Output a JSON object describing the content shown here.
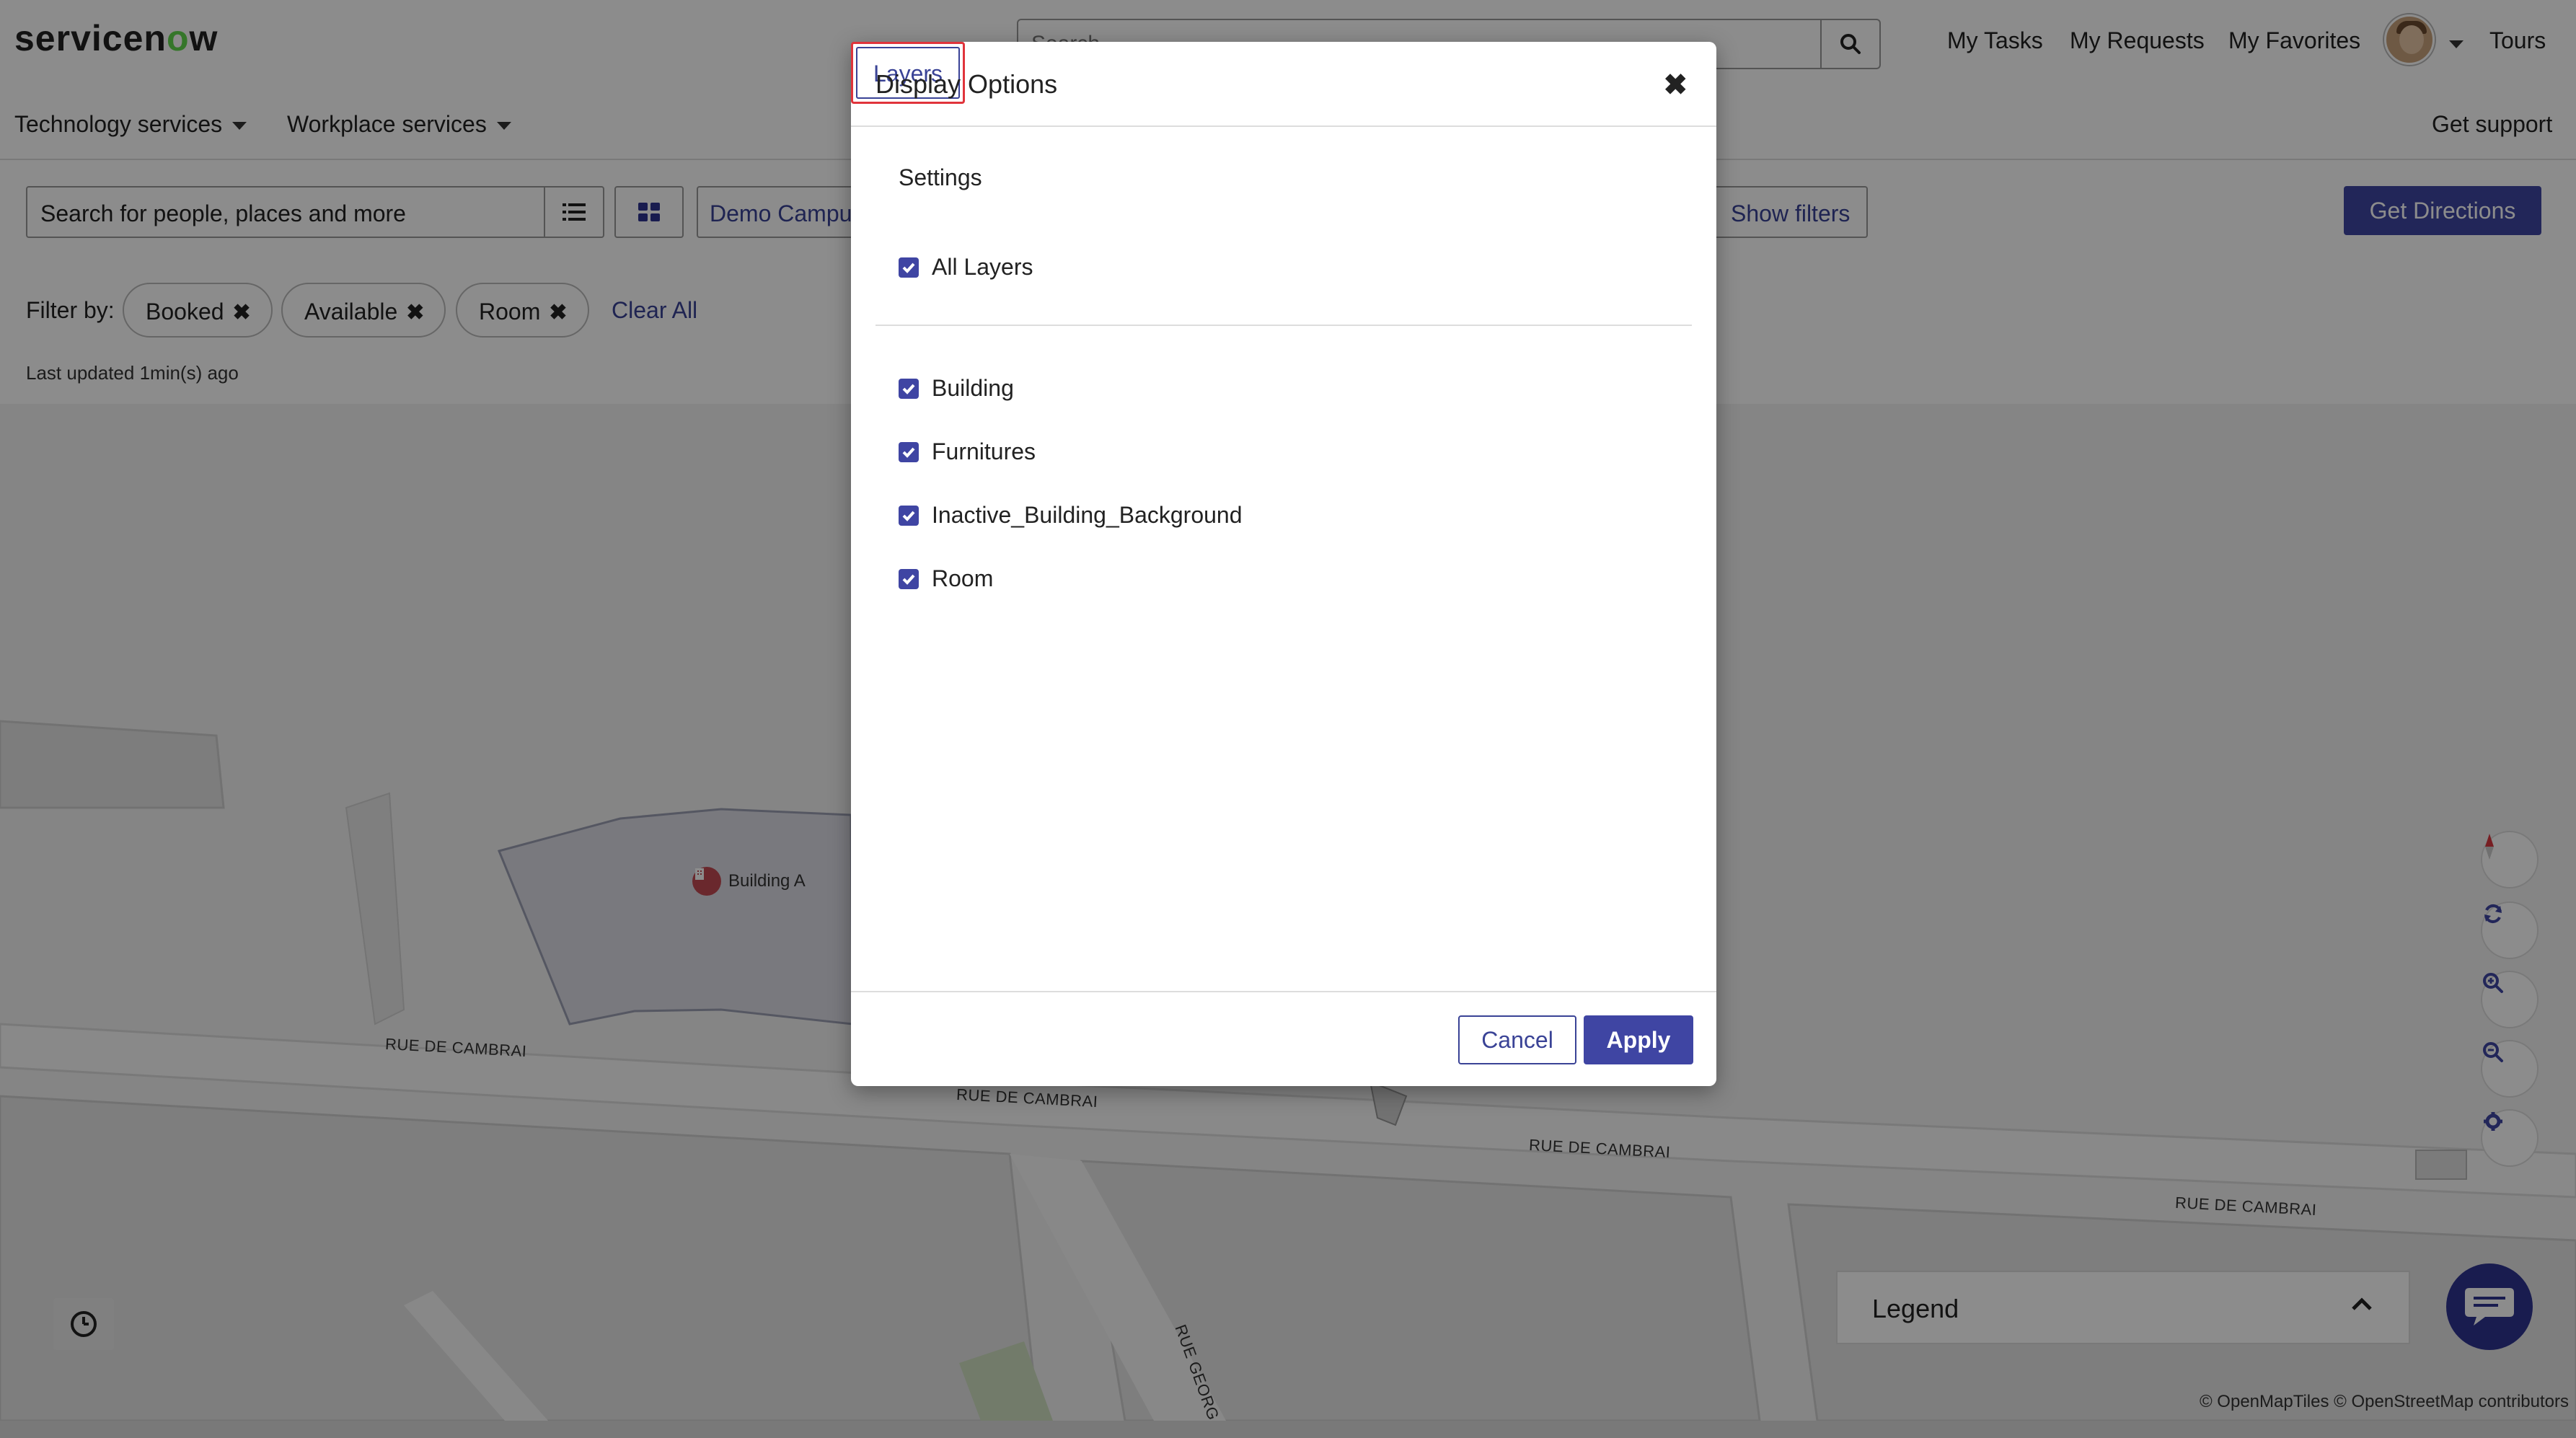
{
  "header": {
    "logo_text_before": "servicen",
    "logo_text_o": "o",
    "logo_text_after": "w",
    "search_placeholder": "Search",
    "nav": {
      "my_tasks": "My Tasks",
      "my_requests": "My Requests",
      "my_favorites": "My Favorites",
      "tours": "Tours"
    },
    "menu": {
      "technology_services": "Technology services",
      "workplace_services": "Workplace services",
      "get_support": "Get support"
    }
  },
  "toolbar": {
    "search_placeholder": "Search for people, places and more",
    "campus_label": "Demo Campus",
    "show_filters_label": "Show filters",
    "get_directions_label": "Get Directions"
  },
  "filters": {
    "filter_by_label": "Filter by:",
    "chips": [
      "Booked",
      "Available",
      "Room"
    ],
    "clear_all_label": "Clear All",
    "last_updated": "Last updated 1min(s) ago"
  },
  "map": {
    "building_label": "Building A",
    "streets": [
      "RUE DE CAMBRAI",
      "RUE DE CAMBRAI",
      "RUE DE CAMBRAI",
      "RUE DE CAMBRAI",
      "RUE GEORG"
    ],
    "legend_label": "Legend",
    "attribution": "© OpenMapTiles © OpenStreetMap contributors",
    "controls": [
      "compass-icon",
      "refresh-icon",
      "zoom-in-icon",
      "zoom-out-icon",
      "settings-gear-icon"
    ]
  },
  "modal": {
    "title": "Display Options",
    "tabs": {
      "settings": "Settings",
      "layers": "Layers"
    },
    "active_tab": "Layers",
    "all_layers": {
      "label": "All Layers",
      "checked": true
    },
    "layers": [
      {
        "label": "Building",
        "checked": true
      },
      {
        "label": "Furnitures",
        "checked": true
      },
      {
        "label": "Inactive_Building_Background",
        "checked": true
      },
      {
        "label": "Room",
        "checked": true
      }
    ],
    "cancel_label": "Cancel",
    "apply_label": "Apply"
  },
  "colors": {
    "brand_primary": "#3f45a3",
    "link": "#3a4396",
    "focus_outline": "#e0343b",
    "building_pin": "#c24a53",
    "chat_button": "#2f3391",
    "logo_accent": "#62d84e"
  }
}
